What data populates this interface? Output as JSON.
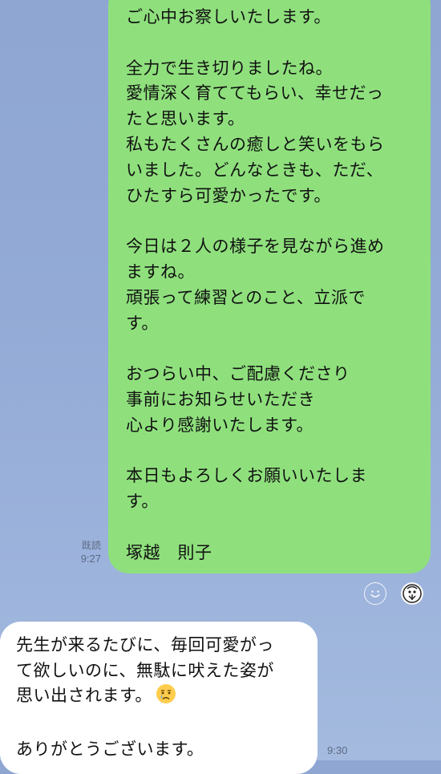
{
  "outgoing_message": {
    "lines": [
      "ご心中お察しいたします。",
      "",
      "全力で生き切りましたね。",
      "愛情深く育ててもらい、幸せだっ",
      "たと思います。",
      "私もたくさんの癒しと笑いをもら",
      "いました。どんなときも、ただ、",
      "ひたすら可愛かったです。",
      "",
      "今日は２人の様子を見ながら進め",
      "ますね。",
      "頑張って練習とのこと、立派で",
      "す。",
      "",
      "おつらい中、ご配慮くださり",
      "事前にお知らせいただき",
      "心より感謝いたします。",
      "",
      "本日もよろしくお願いいたしま",
      "す。",
      "",
      "塚越　則子"
    ],
    "read_label": "既読",
    "time": "9:27"
  },
  "reactions": {
    "smile_icon": "smile-reaction-icon",
    "avatar_icon": "sticker-avatar-icon"
  },
  "incoming_message": {
    "line1": "先生が来るたびに、毎回可愛がっ",
    "line2": "て欲しいのに、無駄に吠えた姿が",
    "line3": "思い出されます。",
    "line3_emoji": "crying-face",
    "line4": "",
    "line5": "ありがとうございます。",
    "time": "9:30"
  },
  "colors": {
    "background": "#93aad6",
    "outgoing_bubble": "#8fe07d",
    "incoming_bubble": "#ffffff"
  }
}
